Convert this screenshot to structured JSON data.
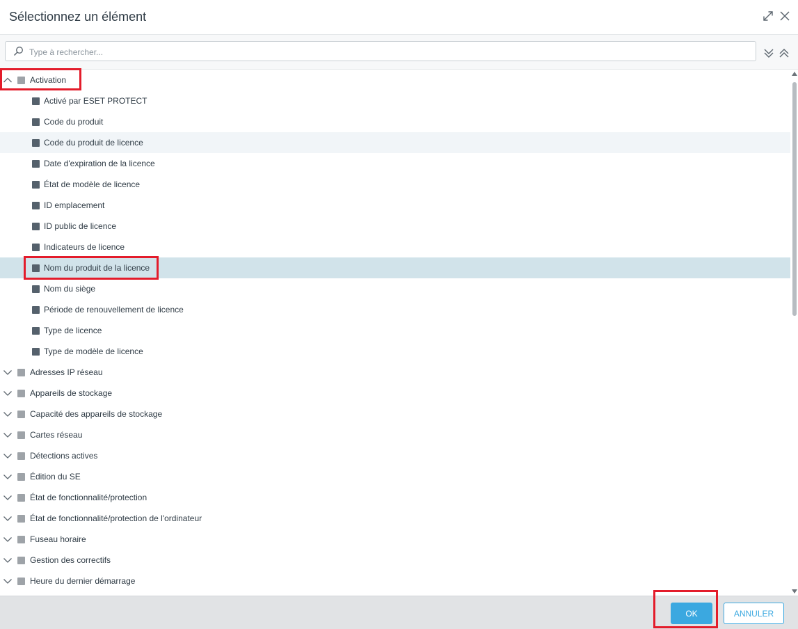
{
  "dialog": {
    "title": "Sélectionnez un élément",
    "icons": {
      "expand": "expand-diagonal-icon",
      "close": "close-icon"
    }
  },
  "search": {
    "placeholder": "Type à rechercher...",
    "value": "",
    "icons": {
      "search": "search-icon",
      "expand_all": "double-chevron-down-icon",
      "collapse_all": "double-chevron-up-icon"
    }
  },
  "tree": {
    "expanded_group": {
      "label": "Activation",
      "children": [
        {
          "label": "Activé par ESET PROTECT"
        },
        {
          "label": "Code du produit"
        },
        {
          "label": "Code du produit de licence"
        },
        {
          "label": "Date d'expiration de la licence"
        },
        {
          "label": "État de modèle de licence"
        },
        {
          "label": "ID emplacement"
        },
        {
          "label": "ID public de licence"
        },
        {
          "label": "Indicateurs de licence"
        },
        {
          "label": "Nom du produit de la licence",
          "selected": true
        },
        {
          "label": "Nom du siège"
        },
        {
          "label": "Période de renouvellement de licence"
        },
        {
          "label": "Type de licence"
        },
        {
          "label": "Type de modèle de licence"
        }
      ]
    },
    "collapsed_groups": [
      {
        "label": "Adresses IP réseau"
      },
      {
        "label": "Appareils de stockage"
      },
      {
        "label": "Capacité des appareils de stockage"
      },
      {
        "label": "Cartes réseau"
      },
      {
        "label": "Détections actives"
      },
      {
        "label": "Édition du SE"
      },
      {
        "label": "État de fonctionnalité/protection"
      },
      {
        "label": "État de fonctionnalité/protection de l'ordinateur"
      },
      {
        "label": "Fuseau horaire"
      },
      {
        "label": "Gestion des correctifs"
      },
      {
        "label": "Heure du dernier démarrage"
      }
    ]
  },
  "footer": {
    "ok_label": "OK",
    "cancel_label": "ANNULER"
  },
  "colors": {
    "accent": "#3ba8e0",
    "selected_row": "#d1e3ea",
    "highlight": "#e31c2b"
  }
}
